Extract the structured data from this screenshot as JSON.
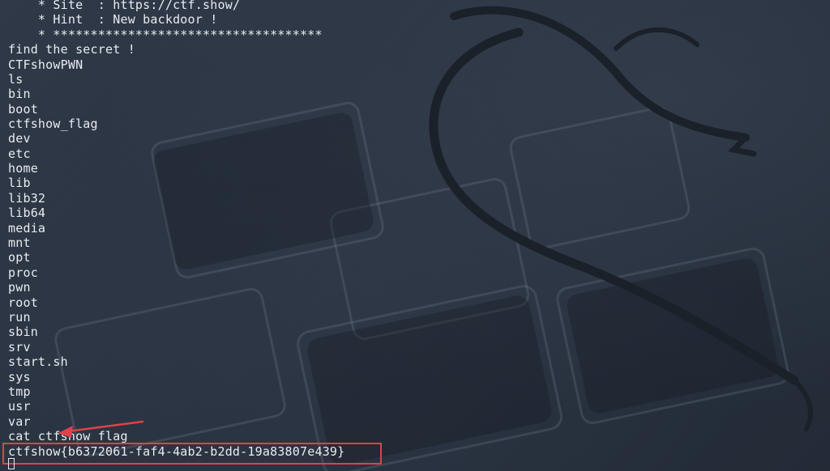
{
  "terminal": {
    "lines": [
      "    * Site  : https://ctf.show/",
      "    * Hint  : New backdoor !",
      "    * ************************************",
      "find the secret !",
      "CTFshowPWN",
      "ls",
      "bin",
      "boot",
      "ctfshow_flag",
      "dev",
      "etc",
      "home",
      "lib",
      "lib32",
      "lib64",
      "media",
      "mnt",
      "opt",
      "proc",
      "pwn",
      "root",
      "run",
      "sbin",
      "srv",
      "start.sh",
      "sys",
      "tmp",
      "usr",
      "var",
      "cat ctfshow_flag",
      "ctfshow{b6372061-faf4-4ab2-b2dd-19a83807e439}"
    ]
  },
  "colors": {
    "background": "#2a3340",
    "text": "#e8ecf0",
    "annotation": "#e0414a"
  },
  "icons": {
    "annotation_arrow": "arrow-icon",
    "cursor": "terminal-cursor"
  }
}
